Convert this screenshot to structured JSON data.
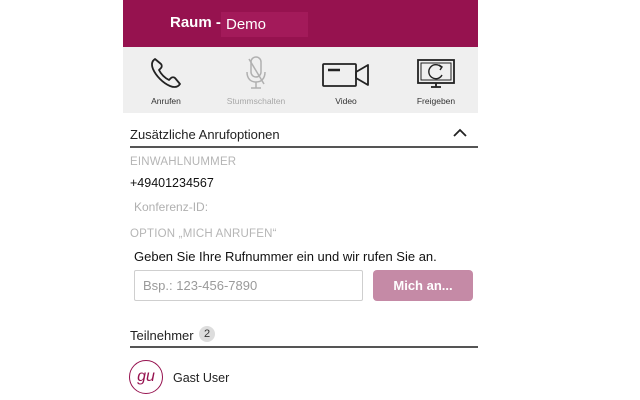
{
  "header": {
    "room_prefix": "Raum -",
    "room_name": "Demo"
  },
  "toolbar": {
    "items": [
      {
        "label": "Anrufen",
        "icon": "phone-icon",
        "enabled": true
      },
      {
        "label": "Stummschalten",
        "icon": "microphone-off-icon",
        "enabled": false
      },
      {
        "label": "Video",
        "icon": "video-camera-icon",
        "enabled": true
      },
      {
        "label": "Freigeben",
        "icon": "screen-share-icon",
        "enabled": true
      }
    ]
  },
  "call_options": {
    "title": "Zusätzliche Anrufoptionen",
    "dial_in_label": "EINWAHLNUMMER",
    "dial_in_number": "+49401234567",
    "conference_id_label": "Konferenz-ID:",
    "call_me_label": "OPTION „MICH ANRUFEN“",
    "call_me_instruction": "Geben Sie Ihre Rufnummer ein und wir rufen Sie an.",
    "phone_placeholder": "Bsp.: 123-456-7890",
    "call_me_button": "Mich an..."
  },
  "participants": {
    "title": "Teilnehmer",
    "count": "2",
    "items": [
      {
        "initials": "gu",
        "name": "Gast User"
      }
    ]
  },
  "colors": {
    "brand": "#96124f",
    "button_disabled": "#c58aa6",
    "toolbar_bg": "#efefef"
  }
}
